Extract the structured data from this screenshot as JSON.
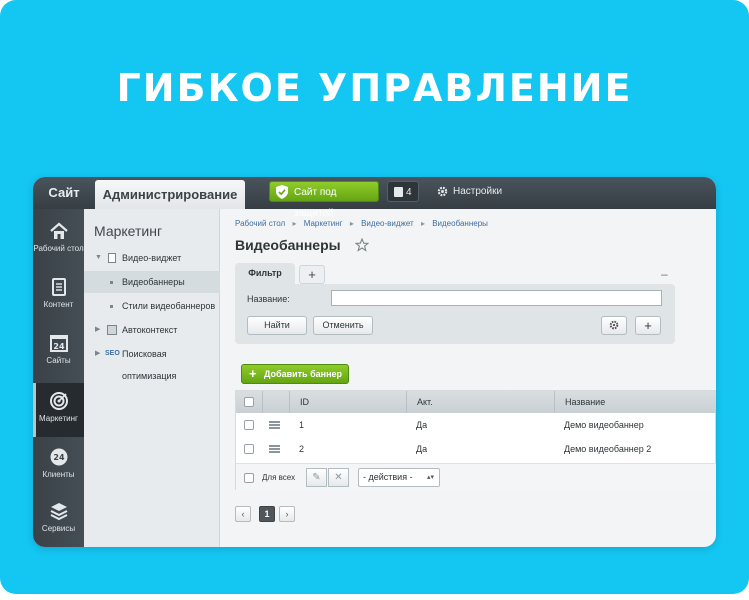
{
  "headline": "ГИБКОЕ УПРАВЛЕНИЕ",
  "topbar": {
    "site_tab": "Сайт",
    "admin_tab": "Администрирование",
    "secure_label": "Сайт под защитой",
    "notifications_count": "4",
    "settings_label": "Настройки"
  },
  "leftnav": {
    "items": [
      {
        "label": "Рабочий стол",
        "icon": "home-icon"
      },
      {
        "label": "Контент",
        "icon": "document-icon"
      },
      {
        "label": "Сайты",
        "icon": "calendar-24-icon"
      },
      {
        "label": "Маркетинг",
        "icon": "target-icon"
      },
      {
        "label": "Клиенты",
        "icon": "clients-24-icon"
      },
      {
        "label": "Сервисы",
        "icon": "layers-icon"
      }
    ]
  },
  "sidemenu": {
    "title": "Маркетинг",
    "items": [
      {
        "label": "Видео-виджет"
      },
      {
        "label": "Видеобаннеры"
      },
      {
        "label": "Стили видеобаннеров"
      },
      {
        "label": "Автоконтекст"
      },
      {
        "label": "Поисковая оптимизация"
      }
    ]
  },
  "breadcrumbs": [
    "Рабочий стол",
    "Маркетинг",
    "Видео-виджет",
    "Видеобаннеры"
  ],
  "page_title": "Видеобаннеры",
  "filter": {
    "tab_label": "Фильтр",
    "add_tab": "+",
    "minimize": "–",
    "name_label": "Название:",
    "name_value": "",
    "find_button": "Найти",
    "cancel_button": "Отменить",
    "add_button": "+"
  },
  "add_banner_button": "Добавить баннер",
  "grid": {
    "columns": [
      "ID",
      "Акт.",
      "Название"
    ],
    "rows": [
      {
        "id": "1",
        "active": "Да",
        "name": "Демо видеобаннер"
      },
      {
        "id": "2",
        "active": "Да",
        "name": "Демо видеобаннер 2"
      }
    ],
    "footer": {
      "for_all": "Для всех",
      "actions": "- действия -"
    }
  },
  "pager": {
    "prev": "‹",
    "current": "1",
    "next": "›"
  },
  "colors": {
    "background": "#14c6f2",
    "accent_green": "#7bbd1f",
    "topbar": "#3f484e"
  }
}
